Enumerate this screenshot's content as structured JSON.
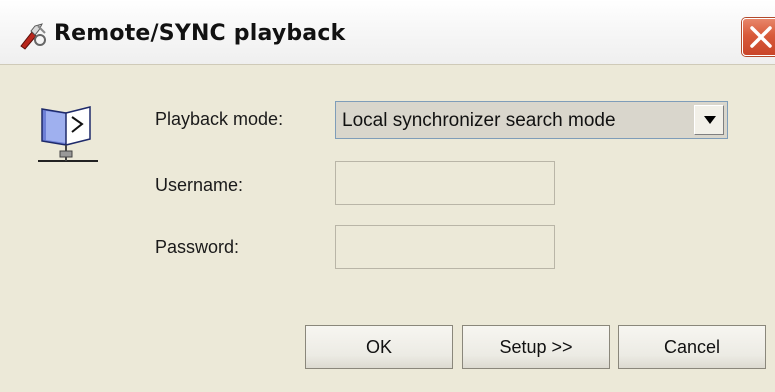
{
  "window": {
    "title": "Remote/SYNC playback",
    "title_icon": "tools-icon",
    "close_icon": "close-icon"
  },
  "form": {
    "playback_mode_label": "Playback mode:",
    "playback_mode_value": "Local synchronizer search mode",
    "username_label": "Username:",
    "username_value": "",
    "password_label": "Password:",
    "password_value": ""
  },
  "buttons": {
    "ok": "OK",
    "setup": "Setup >>",
    "cancel": "Cancel"
  },
  "icons": {
    "dialog": "network-book-icon",
    "dropdown": "chevron-down-icon"
  },
  "colors": {
    "dialog_background": "#ece9d8",
    "close_button": "#d85a3a",
    "combo_background": "#d9d6cc"
  }
}
